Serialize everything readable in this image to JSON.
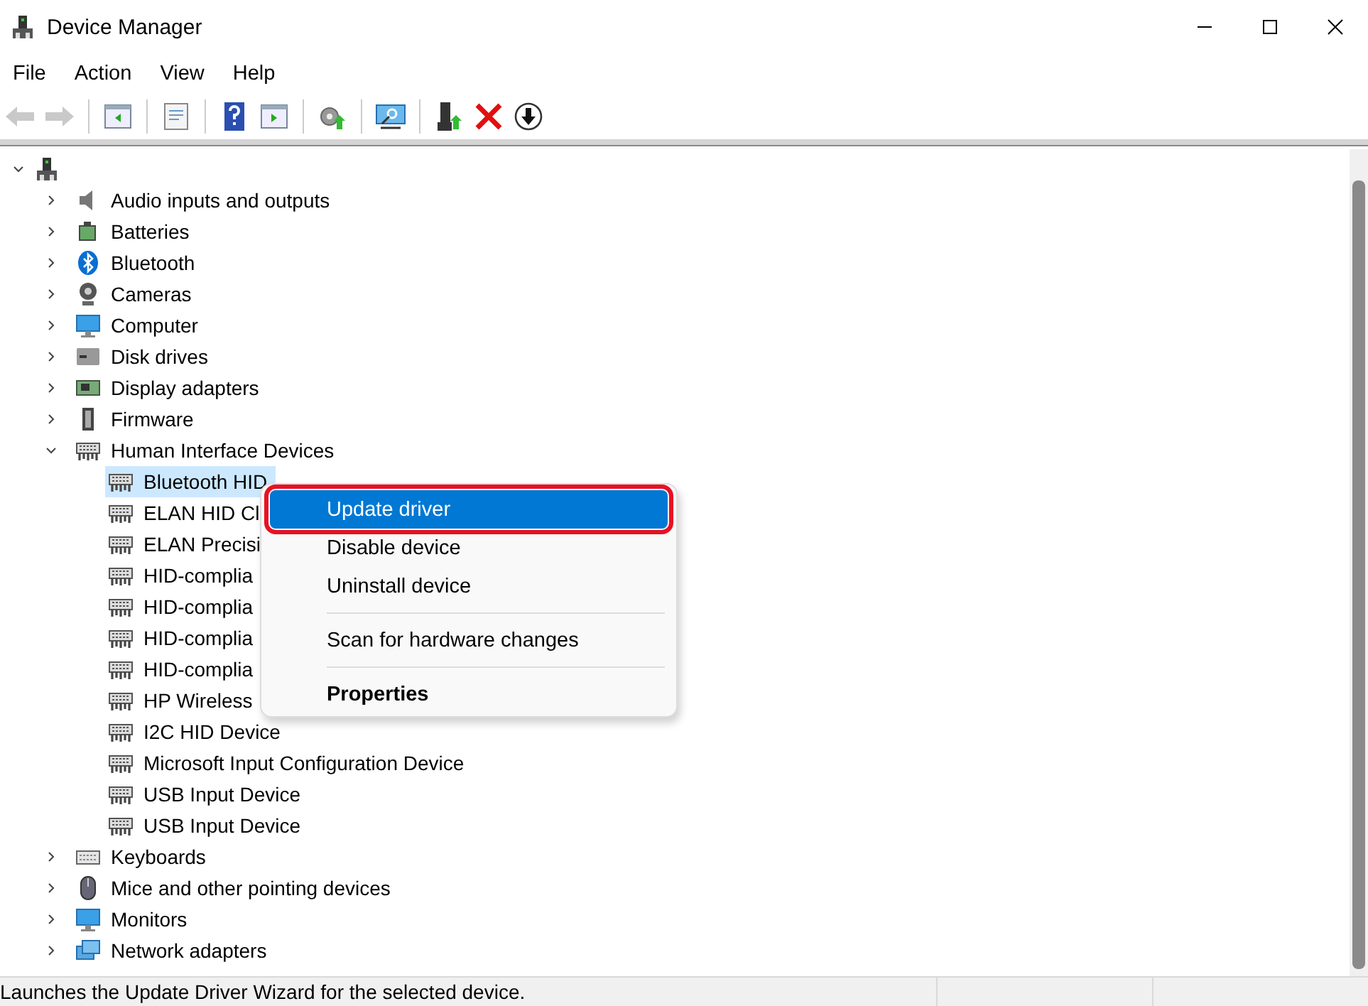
{
  "window": {
    "title": "Device Manager"
  },
  "menu_bar": [
    "File",
    "Action",
    "View",
    "Help"
  ],
  "toolbar": [
    {
      "kind": "button",
      "disabled": true
    },
    {
      "kind": "button",
      "disabled": true
    },
    {
      "kind": "separator"
    },
    {
      "kind": "button",
      "disabled": false
    },
    {
      "kind": "separator"
    },
    {
      "kind": "button",
      "disabled": false
    },
    {
      "kind": "separator"
    },
    {
      "kind": "button",
      "disabled": false
    },
    {
      "kind": "button",
      "disabled": false
    },
    {
      "kind": "separator"
    },
    {
      "kind": "button",
      "disabled": false
    },
    {
      "kind": "separator"
    },
    {
      "kind": "button",
      "disabled": false
    },
    {
      "kind": "separator"
    },
    {
      "kind": "button",
      "disabled": false
    },
    {
      "kind": "button",
      "disabled": false
    },
    {
      "kind": "button",
      "disabled": false
    }
  ],
  "tree": {
    "expanded": true,
    "selected": false,
    "children": [
      {
        "label": "Audio inputs and outputs",
        "expanded": false,
        "selected": false
      },
      {
        "label": "Batteries",
        "expanded": false,
        "selected": false
      },
      {
        "label": "Bluetooth",
        "expanded": false,
        "selected": false
      },
      {
        "label": "Cameras",
        "expanded": false,
        "selected": false
      },
      {
        "label": "Computer",
        "expanded": false,
        "selected": false
      },
      {
        "label": "Disk drives",
        "expanded": false,
        "selected": false
      },
      {
        "label": "Display adapters",
        "expanded": false,
        "selected": false
      },
      {
        "label": "Firmware",
        "expanded": false,
        "selected": false
      },
      {
        "label": "Human Interface Devices",
        "expanded": true,
        "selected": false,
        "children": [
          {
            "label": "Bluetooth HID",
            "selected": true
          },
          {
            "label": "ELAN HID Cl",
            "selected": false
          },
          {
            "label": "ELAN Precisi",
            "selected": false
          },
          {
            "label": "HID-complia",
            "selected": false
          },
          {
            "label": "HID-complia",
            "selected": false
          },
          {
            "label": "HID-complia",
            "selected": false
          },
          {
            "label": "HID-complia",
            "selected": false
          },
          {
            "label": "HP Wireless",
            "selected": false
          },
          {
            "label": "I2C HID Device",
            "selected": false
          },
          {
            "label": "Microsoft Input Configuration Device",
            "selected": false
          },
          {
            "label": "USB Input Device",
            "selected": false
          },
          {
            "label": "USB Input Device",
            "selected": false
          }
        ]
      },
      {
        "label": "Keyboards",
        "expanded": false,
        "selected": false
      },
      {
        "label": "Mice and other pointing devices",
        "expanded": false,
        "selected": false
      },
      {
        "label": "Monitors",
        "expanded": false,
        "selected": false
      },
      {
        "label": "Network adapters",
        "expanded": false,
        "selected": false
      }
    ]
  },
  "context_menu": {
    "items": [
      {
        "kind": "item",
        "label": "Update driver",
        "highlighted": true,
        "outlined": true,
        "default": false
      },
      {
        "kind": "item",
        "label": "Disable device",
        "highlighted": false,
        "outlined": false,
        "default": false
      },
      {
        "kind": "item",
        "label": "Uninstall device",
        "highlighted": false,
        "outlined": false,
        "default": false
      },
      {
        "kind": "separator"
      },
      {
        "kind": "item",
        "label": "Scan for hardware changes",
        "highlighted": false,
        "outlined": false,
        "default": false
      },
      {
        "kind": "separator"
      },
      {
        "kind": "item",
        "label": "Properties",
        "highlighted": false,
        "outlined": false,
        "default": true
      }
    ]
  },
  "status_bar": {
    "text": "Launches the Update Driver Wizard for the selected device."
  }
}
